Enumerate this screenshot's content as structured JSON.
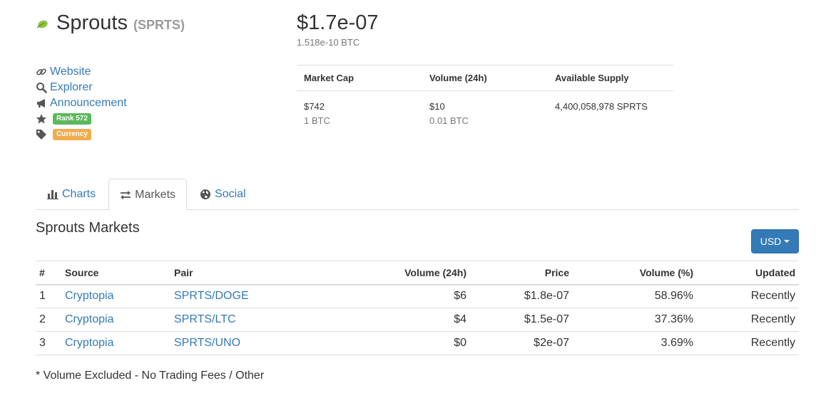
{
  "coin": {
    "name": "Sprouts",
    "symbol": "(SPRTS)",
    "logo_icon": "sprout-leaf-icon",
    "logo_color": "#8dc63f"
  },
  "links": {
    "website": "Website",
    "explorer": "Explorer",
    "announcement": "Announcement",
    "rank": "Rank 572",
    "category": "Currency"
  },
  "price": {
    "usd": "$1.7e-07",
    "btc": "1.518e-10 BTC"
  },
  "stats": {
    "headers": [
      "Market Cap",
      "Volume (24h)",
      "Available Supply"
    ],
    "market_cap_usd": "$742",
    "market_cap_btc": "1 BTC",
    "volume_usd": "$10",
    "volume_btc": "0.01 BTC",
    "supply": "4,400,058,978 SPRTS"
  },
  "tabs": [
    {
      "label": "Charts",
      "icon": "bar-chart-icon",
      "active": false
    },
    {
      "label": "Markets",
      "icon": "exchange-arrows-icon",
      "active": true
    },
    {
      "label": "Social",
      "icon": "globe-icon",
      "active": false
    }
  ],
  "markets": {
    "title": "Sprouts Markets",
    "currency_button": "USD",
    "columns": [
      "#",
      "Source",
      "Pair",
      "Volume (24h)",
      "Price",
      "Volume (%)",
      "Updated"
    ],
    "rows": [
      {
        "num": "1",
        "source": "Cryptopia",
        "pair": "SPRTS/DOGE",
        "volume": "$6",
        "price": "$1.8e-07",
        "pct": "58.96%",
        "updated": "Recently"
      },
      {
        "num": "2",
        "source": "Cryptopia",
        "pair": "SPRTS/LTC",
        "volume": "$4",
        "price": "$1.5e-07",
        "pct": "37.36%",
        "updated": "Recently"
      },
      {
        "num": "3",
        "source": "Cryptopia",
        "pair": "SPRTS/UNO",
        "volume": "$0",
        "price": "$2e-07",
        "pct": "3.69%",
        "updated": "Recently"
      }
    ],
    "footnote": "* Volume Excluded - No Trading Fees / Other"
  },
  "colors": {
    "link": "#337ab7",
    "rank_badge": "#5cb85c",
    "category_badge": "#f0ad4e",
    "button": "#337ab7",
    "muted": "#777777"
  }
}
